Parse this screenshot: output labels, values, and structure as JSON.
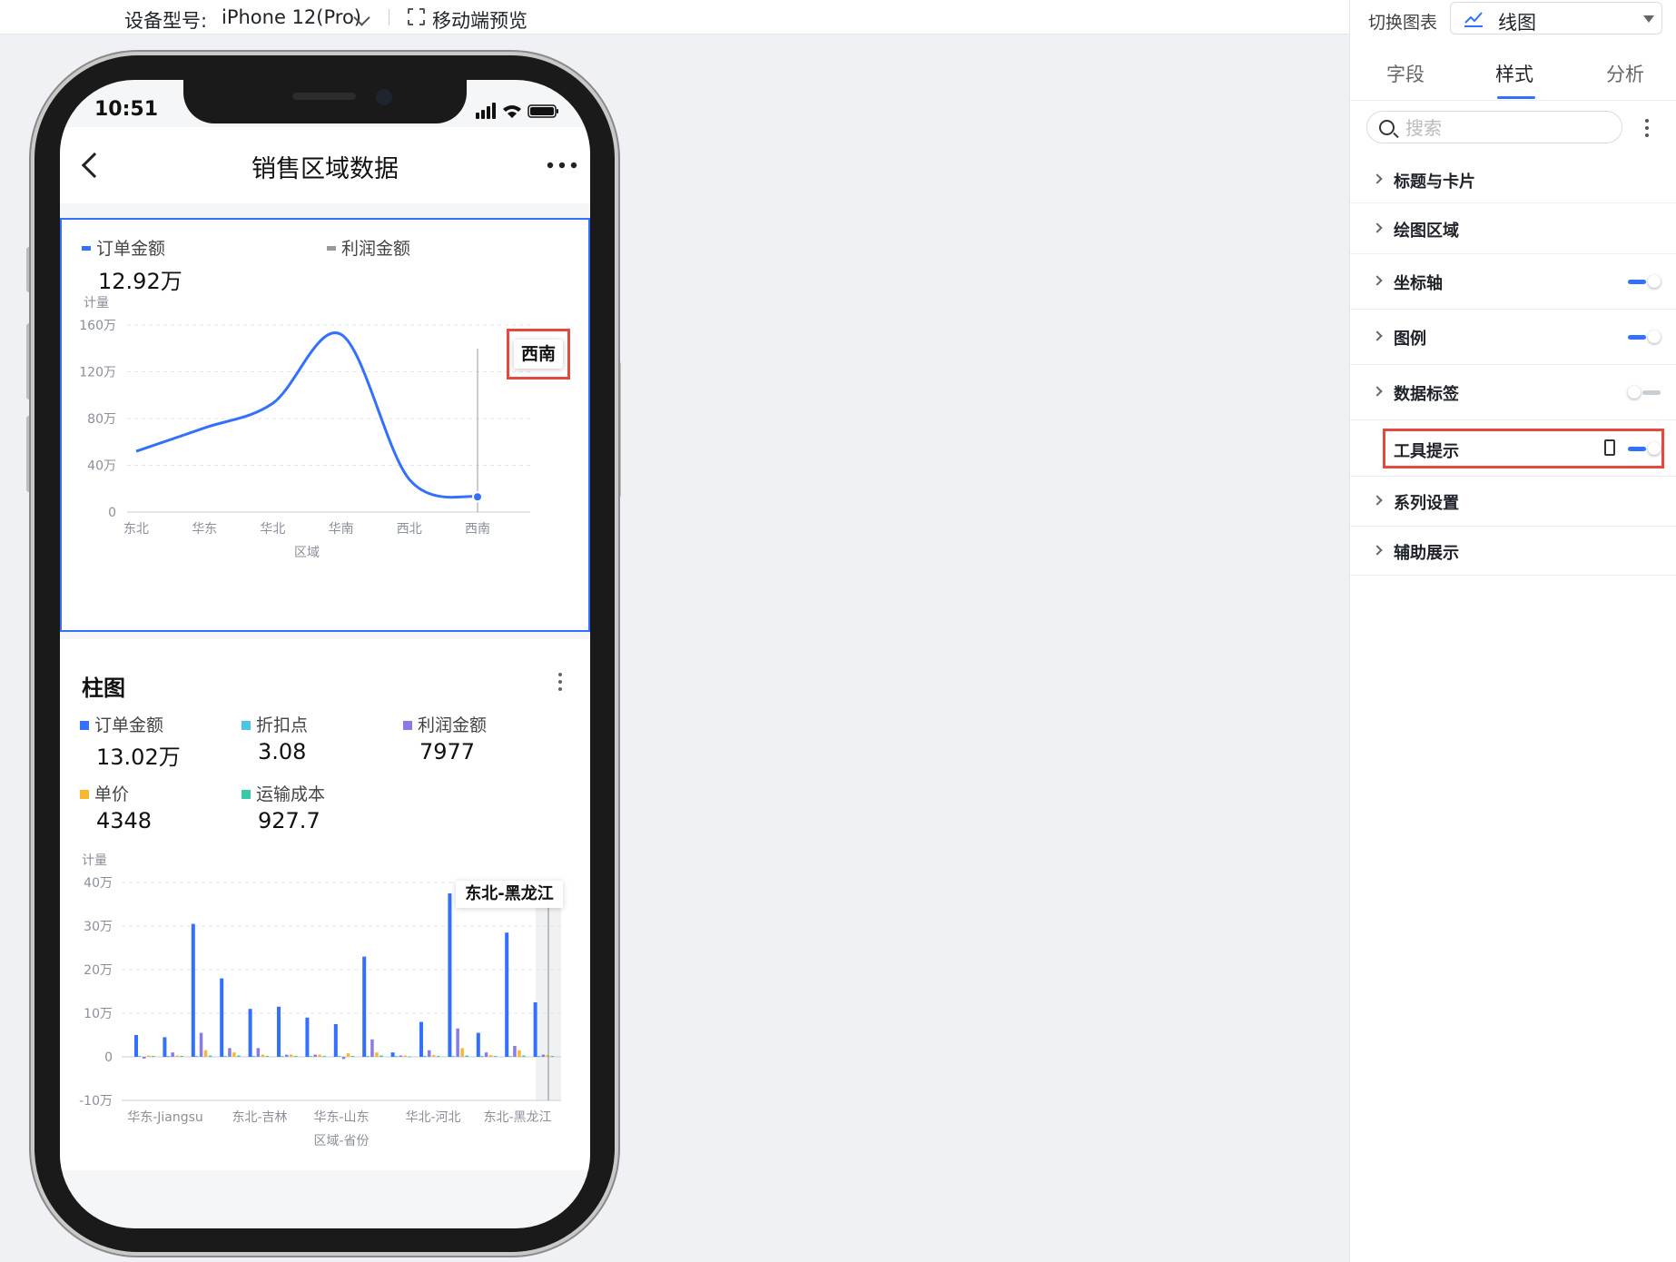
{
  "topbar": {
    "device_label": "设备型号:",
    "device_value": "iPhone 12(Pro)",
    "preview_label": "移动端预览"
  },
  "phone": {
    "status_time": "10:51",
    "page_title": "销售区域数据"
  },
  "line_card": {
    "legend": [
      {
        "name": "订单金额",
        "value": "12.92万",
        "color": "#3370ff"
      },
      {
        "name": "利润金额",
        "color": "#999999"
      }
    ],
    "tooltip": "西南"
  },
  "bar_card": {
    "title": "柱图",
    "legend": [
      {
        "name": "订单金额",
        "value": "13.02万",
        "color": "#3370ff"
      },
      {
        "name": "折扣点",
        "value": "3.08",
        "color": "#4ec3e8"
      },
      {
        "name": "利润金额",
        "value": "7977",
        "color": "#8a7ae6"
      },
      {
        "name": "单价",
        "value": "4348",
        "color": "#f7b731"
      },
      {
        "name": "运输成本",
        "value": "927.7",
        "color": "#3ac9a6"
      }
    ],
    "tooltip": "东北-黑龙江"
  },
  "chart_data": [
    {
      "type": "line",
      "title": "",
      "xlabel": "区域",
      "ylabel": "计量",
      "categories": [
        "东北",
        "华东",
        "华北",
        "华南",
        "西北",
        "西南"
      ],
      "series": [
        {
          "name": "订单金额",
          "values": [
            52,
            72,
            93,
            152,
            28,
            13
          ]
        }
      ],
      "value_unit": "万",
      "ylim": [
        0,
        160
      ],
      "yticks": [
        "0",
        "40万",
        "80万",
        "120万",
        "160万"
      ],
      "grid": true,
      "legend": "top-left",
      "color": "#3370ff"
    },
    {
      "type": "bar",
      "title": "柱图",
      "xlabel": "区域-省份",
      "ylabel": "计量",
      "categories": [
        "华东-Jiangsu",
        "东北-吉林",
        "华东-山东",
        "华北-河北",
        "东北-黑龙江"
      ],
      "value_unit": "万",
      "ylim": [
        -10,
        40
      ],
      "yticks": [
        "-10万",
        "0",
        "10万",
        "20万",
        "30万",
        "40万"
      ],
      "grid": true,
      "legend": "top-left",
      "series": [
        {
          "name": "订单金额",
          "color": "#3370ff",
          "values": [
            5,
            4.5,
            30.5,
            18,
            11,
            11.5,
            9,
            7.5,
            23,
            1,
            8,
            37.5,
            5.5,
            28.5,
            12.5
          ]
        },
        {
          "name": "折扣点",
          "color": "#4ec3e8",
          "values": [
            0.2,
            0.2,
            0.2,
            0.2,
            0.2,
            0.2,
            0.2,
            0.2,
            0.2,
            0.2,
            0.2,
            0.2,
            0.2,
            0.2,
            0.2
          ]
        },
        {
          "name": "利润金额",
          "color": "#8a7ae6",
          "values": [
            -0.4,
            1,
            5.5,
            2,
            2,
            0.5,
            0.5,
            -0.5,
            4,
            0.3,
            1.5,
            6.5,
            1,
            2.5,
            0.5
          ]
        },
        {
          "name": "单价",
          "color": "#f7b731",
          "values": [
            0.3,
            0.3,
            1.5,
            1,
            0.5,
            0.5,
            0.5,
            0.8,
            1,
            0.3,
            0.4,
            2,
            0.4,
            1.5,
            0.4
          ]
        },
        {
          "name": "运输成本",
          "color": "#3ac9a6",
          "values": [
            0.2,
            0.2,
            0.3,
            0.3,
            0.2,
            0.2,
            0.2,
            0.2,
            0.3,
            0.1,
            0.2,
            0.3,
            0.2,
            0.3,
            0.2
          ]
        }
      ]
    }
  ],
  "panel": {
    "switch_label": "切换图表",
    "chart_type": "线图",
    "tabs": [
      "字段",
      "样式",
      "分析"
    ],
    "search_placeholder": "搜索",
    "sections": [
      {
        "label": "标题与卡片"
      },
      {
        "label": "绘图区域"
      },
      {
        "label": "坐标轴",
        "toggle": true
      },
      {
        "label": "图例",
        "toggle": true
      },
      {
        "label": "数据标签",
        "toggle": false
      },
      {
        "label": "工具提示",
        "toggle": true
      },
      {
        "label": "系列设置"
      },
      {
        "label": "辅助展示"
      }
    ]
  }
}
